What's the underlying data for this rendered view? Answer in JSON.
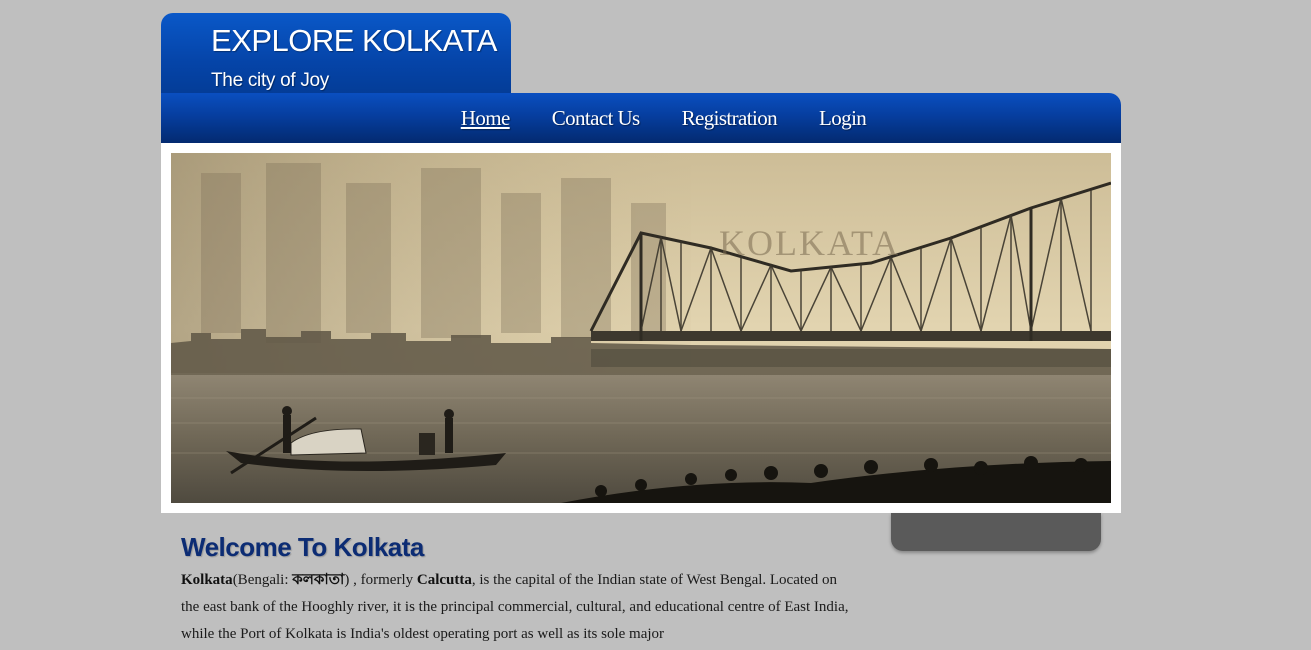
{
  "header": {
    "title": "EXPLORE KOLKATA",
    "slogan": "The city of Joy"
  },
  "nav": {
    "items": [
      {
        "label": "Home",
        "active": true
      },
      {
        "label": "Contact Us",
        "active": false
      },
      {
        "label": "Registration",
        "active": false
      },
      {
        "label": "Login",
        "active": false
      }
    ]
  },
  "banner": {
    "caption": "KOLKATA"
  },
  "main": {
    "heading": "Welcome To Kolkata",
    "intro": {
      "name": "Kolkata",
      "bengali_prefix": "(Bengali: ",
      "bengali_name": "কলকাতা",
      "former_prefix": ") , formerly ",
      "former_name": "Calcutta",
      "rest_line1": ", is the capital of the Indian state of West Bengal.",
      "rest_more": "Located on the east bank of the Hooghly river, it is the principal commercial, cultural, and educational centre of East India, while the Port of Kolkata is India's oldest operating port as well as its sole major"
    }
  },
  "colors": {
    "page_bg": "#bfbfbf",
    "header_blue": "#0544a8",
    "heading_color": "#0c2c74",
    "sidebar_box": "#5a5a5a"
  }
}
